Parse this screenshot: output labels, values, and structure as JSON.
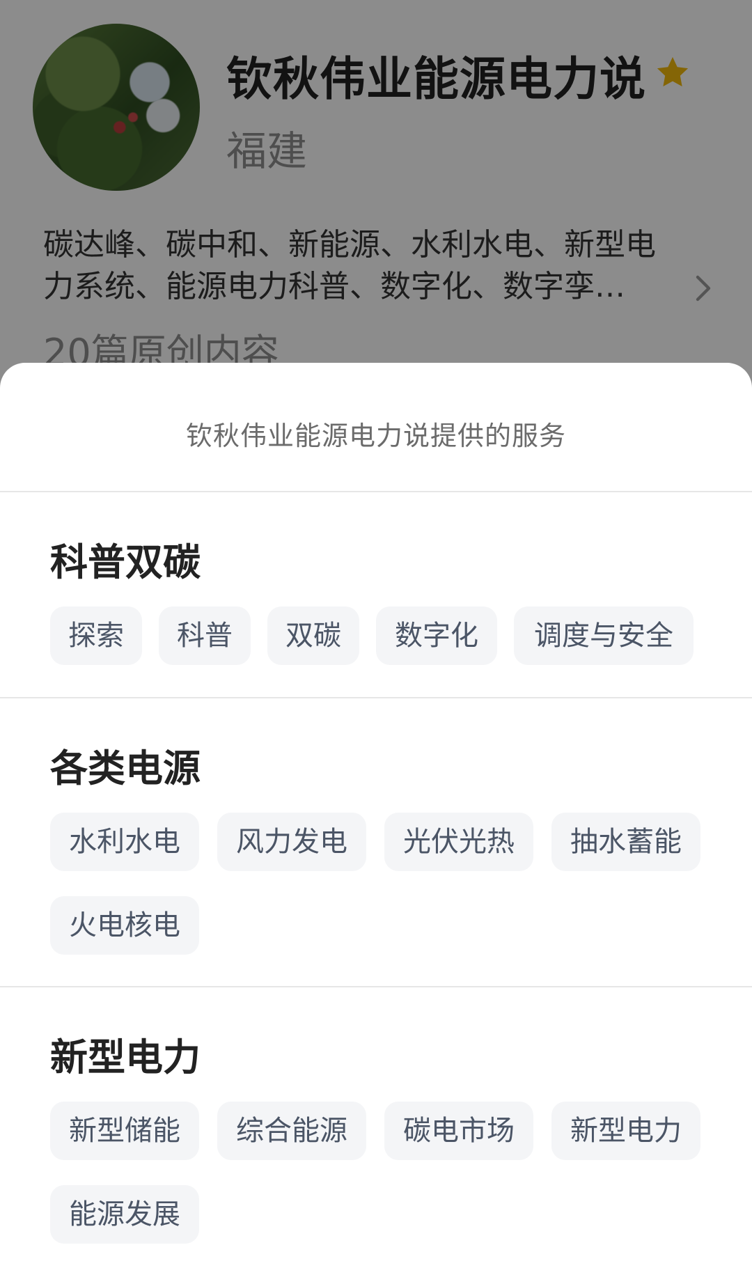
{
  "profile": {
    "name": "钦秋伟业能源电力说",
    "region": "福建",
    "bio_line1": "碳达峰、碳中和、新能源、水利水电、新型电",
    "bio_line2": "力系统、能源电力科普、数字化、数字孪…",
    "stats": "20篇原创内容",
    "star_icon": "star-icon",
    "star_color": "#f0b90b",
    "chevron_icon": "chevron-right-icon"
  },
  "sheet": {
    "title": "钦秋伟业能源电力说提供的服务",
    "sections": [
      {
        "title": "科普双碳",
        "tags": [
          "探索",
          "科普",
          "双碳",
          "数字化",
          "调度与安全"
        ]
      },
      {
        "title": "各类电源",
        "tags": [
          "水利水电",
          "风力发电",
          "光伏光热",
          "抽水蓄能",
          "火电核电"
        ]
      },
      {
        "title": "新型电力",
        "tags": [
          "新型储能",
          "综合能源",
          "碳电市场",
          "新型电力",
          "能源发展"
        ]
      }
    ]
  }
}
